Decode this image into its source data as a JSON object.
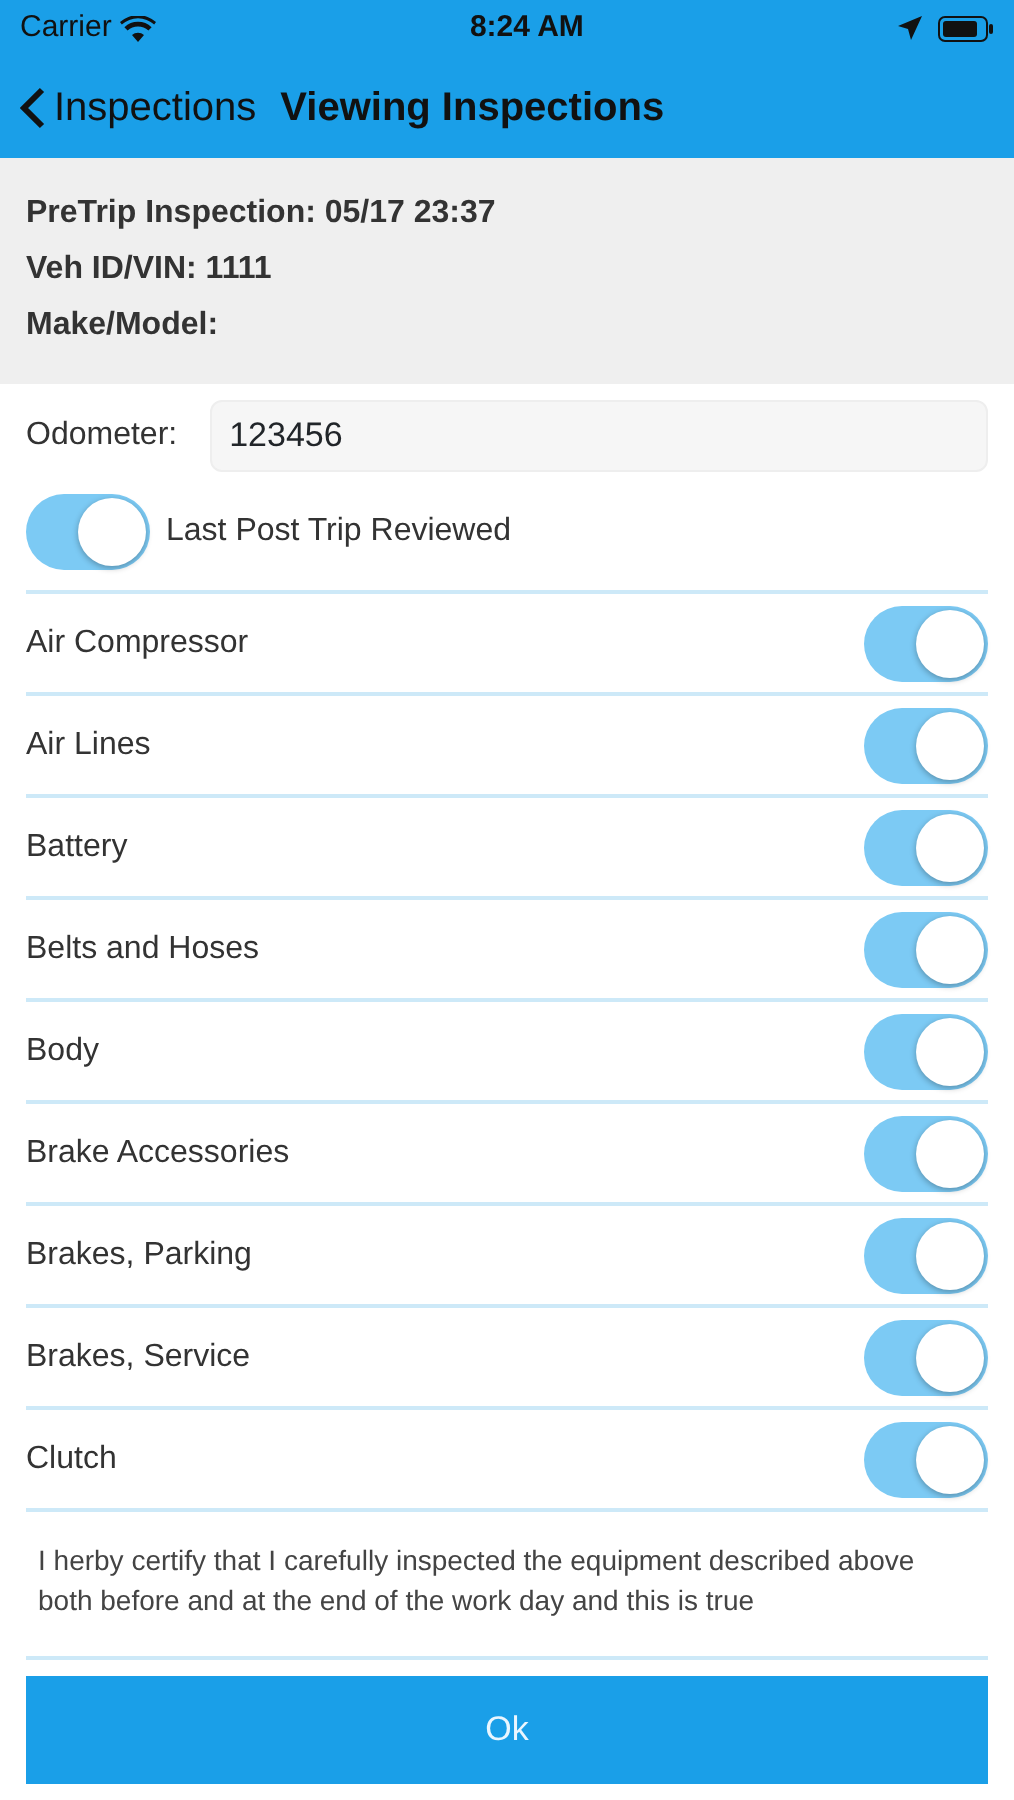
{
  "status_bar": {
    "carrier": "Carrier",
    "time": "8:24 AM"
  },
  "nav": {
    "back_label": "Inspections",
    "title": "Viewing Inspections"
  },
  "info": [
    "PreTrip Inspection: 05/17 23:37",
    "Veh ID/VIN: 1111",
    "Make/Model:"
  ],
  "odometer": {
    "label": "Odometer:",
    "value": "123456"
  },
  "last_post_trip": {
    "label": "Last Post Trip Reviewed",
    "on": true
  },
  "items": [
    {
      "label": "Air Compressor",
      "on": true
    },
    {
      "label": "Air Lines",
      "on": true
    },
    {
      "label": "Battery",
      "on": true
    },
    {
      "label": "Belts and Hoses",
      "on": true
    },
    {
      "label": "Body",
      "on": true
    },
    {
      "label": "Brake Accessories",
      "on": true
    },
    {
      "label": "Brakes, Parking",
      "on": true
    },
    {
      "label": "Brakes, Service",
      "on": true
    },
    {
      "label": "Clutch",
      "on": true
    }
  ],
  "certification": "I herby certify that I carefully inspected the equipment described above both before and at the end of the work day and this is true",
  "ok_button": "Ok"
}
